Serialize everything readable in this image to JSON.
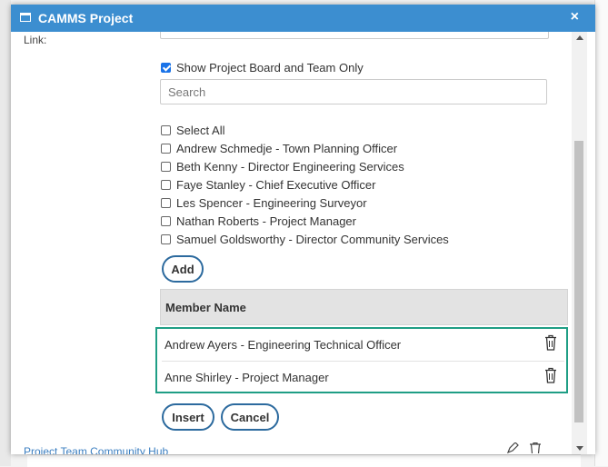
{
  "dialog": {
    "title": "CAMMS Project",
    "close_symbol": "×"
  },
  "form": {
    "link_label": "Link:",
    "show_board_label": "Show Project Board and Team Only",
    "show_board_checked": true,
    "search_placeholder": "Search",
    "select_all_label": "Select All",
    "people": [
      {
        "label": "Andrew Schmedje - Town Planning Officer",
        "checked": false
      },
      {
        "label": "Beth Kenny - Director Engineering Services",
        "checked": false
      },
      {
        "label": "Faye Stanley - Chief Executive Officer",
        "checked": false
      },
      {
        "label": "Les Spencer - Engineering Surveyor",
        "checked": false
      },
      {
        "label": "Nathan Roberts - Project Manager",
        "checked": false
      },
      {
        "label": "Samuel Goldsworthy - Director Community Services",
        "checked": false
      }
    ],
    "add_label": "Add"
  },
  "members_table": {
    "header": "Member Name",
    "rows": [
      {
        "name": "Andrew Ayers - Engineering Technical Officer",
        "action_icon": "trash-icon"
      },
      {
        "name": "Anne Shirley - Project Manager",
        "action_icon": "trash-icon"
      }
    ]
  },
  "actions": {
    "insert_label": "Insert",
    "cancel_label": "Cancel"
  },
  "footer": {
    "link_text": "Project Team Community Hub"
  },
  "colors": {
    "titlebar": "#3c8ed0",
    "highlight_border": "#1f9e85",
    "button_border": "#2c6a9e",
    "checkbox_checked": "#1a73e8"
  }
}
